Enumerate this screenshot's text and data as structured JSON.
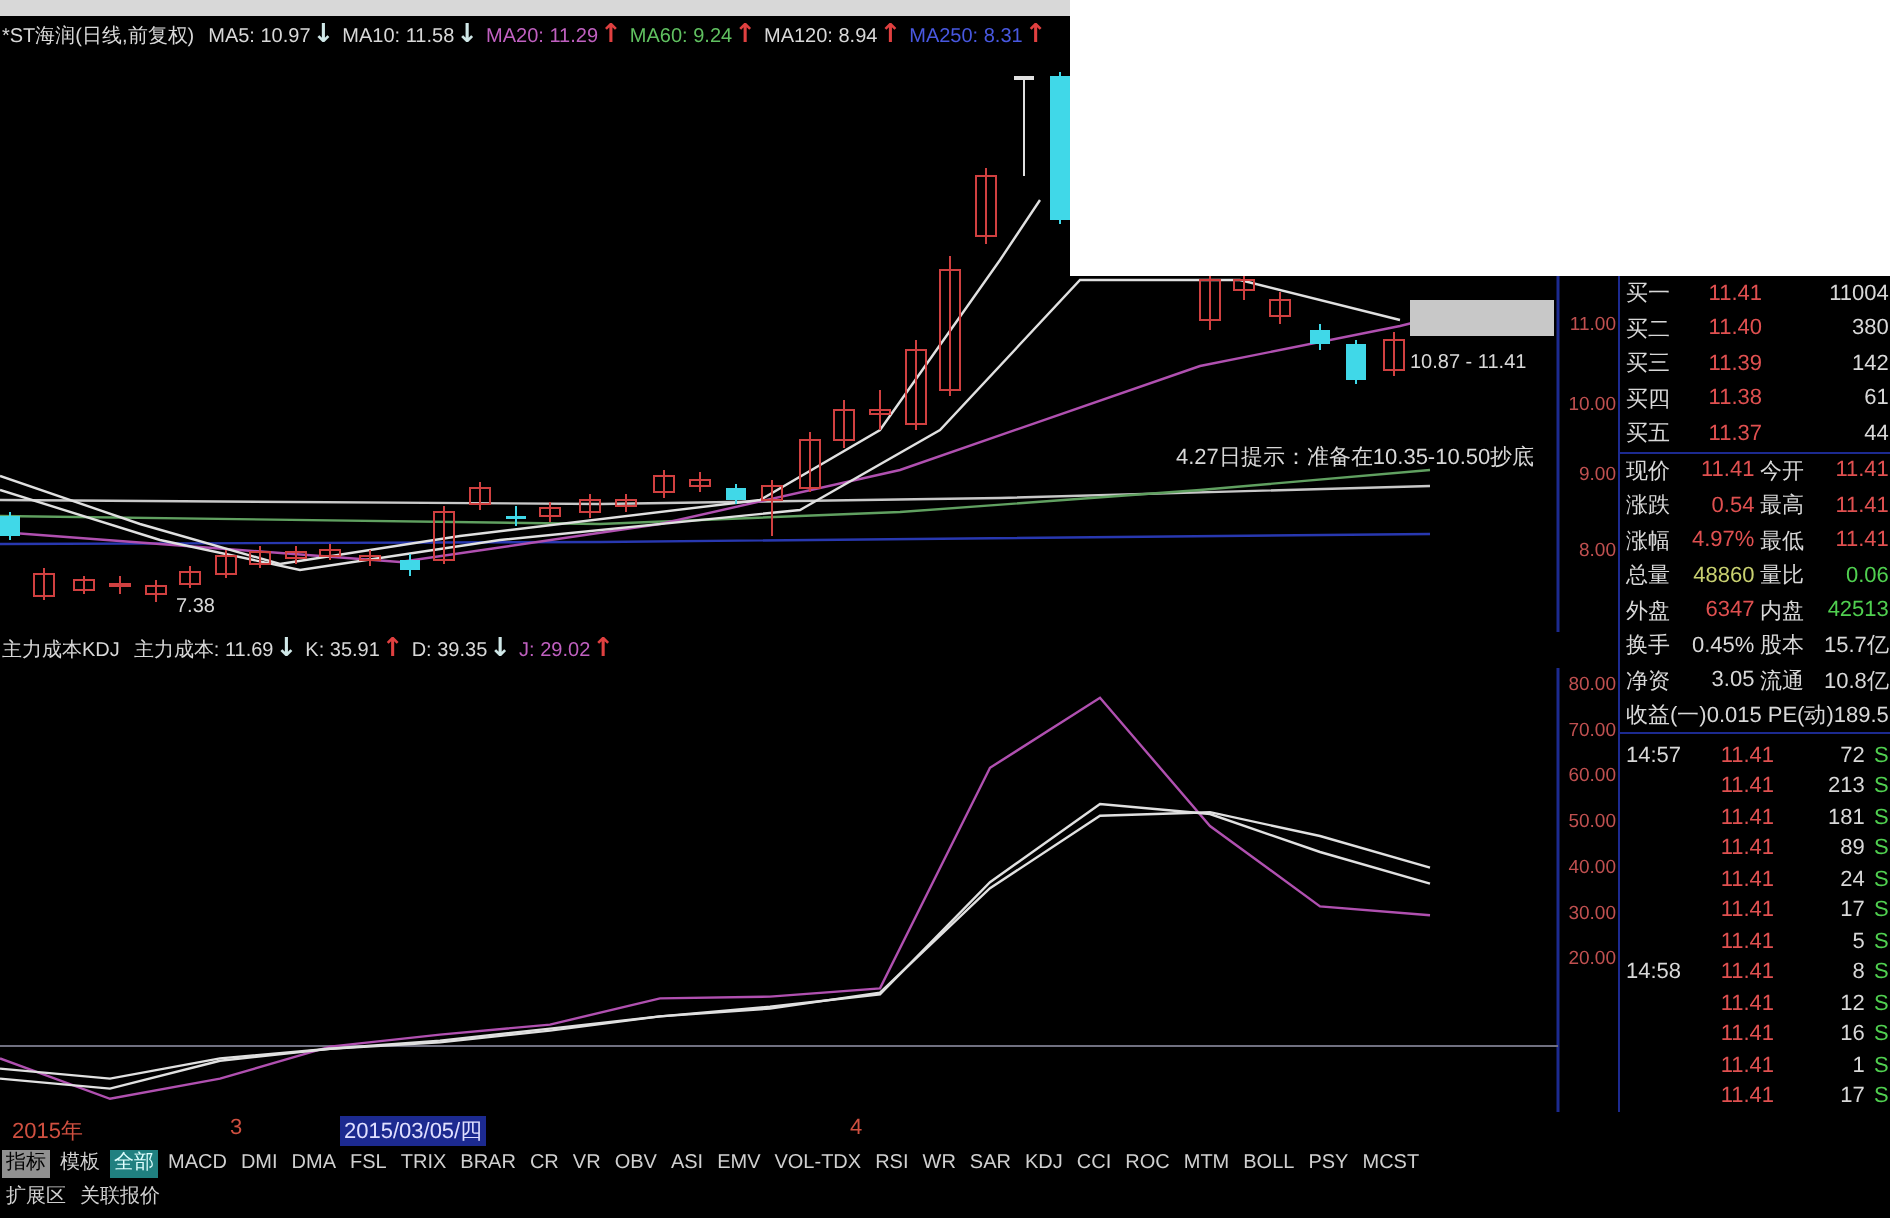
{
  "price_legend": {
    "title": "*ST海润(日线,前复权)",
    "indicators": [
      {
        "label": "MA5: 10.97",
        "color": "#d8d8d8",
        "arrow": {
          "symbol": "↓",
          "color": "#d0e8e8"
        }
      },
      {
        "label": "MA10: 11.58",
        "color": "#d8d8d8",
        "arrow": {
          "symbol": "↓",
          "color": "#d0e8e8"
        }
      },
      {
        "label": "MA20: 11.29",
        "color": "#c060c0",
        "arrow": {
          "symbol": "↑",
          "color": "#e04040"
        }
      },
      {
        "label": "MA60: 9.24",
        "color": "#60c060",
        "arrow": {
          "symbol": "↑",
          "color": "#e04040"
        }
      },
      {
        "label": "MA120: 8.94",
        "color": "#d8d8d8",
        "arrow": {
          "symbol": "↑",
          "color": "#e04040"
        }
      },
      {
        "label": "MA250: 8.31",
        "color": "#4858e0",
        "arrow": {
          "symbol": "↑",
          "color": "#e04040"
        }
      }
    ]
  },
  "price_chart": {
    "low_label": "7.38",
    "range_label": "10.87 - 11.41",
    "hint": "4.27日提示：准备在10.35-10.50抄底",
    "axis": [
      "11.00",
      "10.00",
      "9.00",
      "8.00"
    ]
  },
  "kdj_legend": {
    "title": "主力成本KDJ",
    "indicators": [
      {
        "label": "主力成本: 11.69",
        "color": "#d8d8d8",
        "arrow": {
          "symbol": "↓",
          "color": "#d0e8e8"
        }
      },
      {
        "label": "K: 35.91",
        "color": "#d8d8d8",
        "arrow": {
          "symbol": "↑",
          "color": "#e04040"
        }
      },
      {
        "label": "D: 39.35",
        "color": "#d8d8d8",
        "arrow": {
          "symbol": "↓",
          "color": "#d0e8e8"
        }
      },
      {
        "label": "J: 29.02",
        "color": "#c060c0",
        "arrow": {
          "symbol": "↑",
          "color": "#e04040"
        }
      }
    ]
  },
  "kdj_chart": {
    "chart_data": {
      "type": "line",
      "ylim": [
        -14,
        83
      ],
      "yticks": [
        {
          "value": 80,
          "label": "80.00"
        },
        {
          "value": 70,
          "label": "70.00"
        },
        {
          "value": 60,
          "label": "60.00"
        },
        {
          "value": 50,
          "label": "50.00"
        },
        {
          "value": 40,
          "label": "40.00"
        },
        {
          "value": 30,
          "label": "30.00"
        },
        {
          "value": 20,
          "label": "20.00"
        }
      ],
      "series": [
        {
          "color": "#b050b0",
          "values": [
            -2.3,
            -11.1,
            -6.7,
            0.3,
            2.9,
            5.1,
            10.8,
            11.2,
            13.0,
            61.2,
            76.5,
            48.5,
            30.9,
            29.0
          ]
        },
        {
          "color": "#e0e0e0",
          "values": [
            -6.7,
            -8.9,
            -2.8,
            -0.2,
            1.2,
            3.8,
            6.9,
            9.0,
            11.7,
            36.2,
            53.3,
            51.1,
            42.8,
            35.9
          ]
        },
        {
          "color": "#e0e0e0",
          "values": [
            -4.5,
            -6.7,
            -2.3,
            -0.2,
            1.6,
            4.2,
            6.9,
            8.6,
            12.1,
            34.9,
            50.7,
            51.5,
            46.3,
            39.4
          ]
        }
      ]
    }
  },
  "date_axis": [
    {
      "label": "2015年",
      "highlighted": false
    },
    {
      "label": "3",
      "highlighted": false
    },
    {
      "label": "2015/03/05/四",
      "highlighted": true
    },
    {
      "label": "4",
      "highlighted": false
    }
  ],
  "panel_tabs": [
    {
      "label": "指标",
      "selected": true
    },
    {
      "label": "模板",
      "selected": false
    }
  ],
  "indicator_tabs": [
    {
      "label": "全部",
      "selected": true
    },
    {
      "label": "MACD",
      "selected": false
    },
    {
      "label": "DMI",
      "selected": false
    },
    {
      "label": "DMA",
      "selected": false
    },
    {
      "label": "FSL",
      "selected": false
    },
    {
      "label": "TRIX",
      "selected": false
    },
    {
      "label": "BRAR",
      "selected": false
    },
    {
      "label": "CR",
      "selected": false
    },
    {
      "label": "VR",
      "selected": false
    },
    {
      "label": "OBV",
      "selected": false
    },
    {
      "label": "ASI",
      "selected": false
    },
    {
      "label": "EMV",
      "selected": false
    },
    {
      "label": "VOL-TDX",
      "selected": false
    },
    {
      "label": "RSI",
      "selected": false
    },
    {
      "label": "WR",
      "selected": false
    },
    {
      "label": "SAR",
      "selected": false
    },
    {
      "label": "KDJ",
      "selected": false
    },
    {
      "label": "CCI",
      "selected": false
    },
    {
      "label": "ROC",
      "selected": false
    },
    {
      "label": "MTM",
      "selected": false
    },
    {
      "label": "BOLL",
      "selected": false
    },
    {
      "label": "PSY",
      "selected": false
    },
    {
      "label": "MCST",
      "selected": false
    }
  ],
  "bottom_tabs": [
    "扩展区",
    "关联报价"
  ],
  "order_book": [
    {
      "label": "买一",
      "price": "11.41",
      "volume": "11004"
    },
    {
      "label": "买二",
      "price": "11.40",
      "volume": "380"
    },
    {
      "label": "买三",
      "price": "11.39",
      "volume": "142"
    },
    {
      "label": "买四",
      "price": "11.38",
      "volume": "61"
    },
    {
      "label": "买五",
      "price": "11.37",
      "volume": "44"
    }
  ],
  "quote": [
    {
      "label": "现价",
      "value": "11.41",
      "color": "#e05050"
    },
    {
      "label": "今开",
      "value": "11.41",
      "color": "#e05050"
    },
    {
      "label": "涨跌",
      "value": "0.54",
      "color": "#e05050"
    },
    {
      "label": "最高",
      "value": "11.41",
      "color": "#e05050"
    },
    {
      "label": "涨幅",
      "value": "4.97%",
      "color": "#e05050"
    },
    {
      "label": "最低",
      "value": "11.41",
      "color": "#e05050"
    },
    {
      "label": "总量",
      "value": "48860",
      "color": "#c8d070"
    },
    {
      "label": "量比",
      "value": "0.06",
      "color": "#50d050"
    },
    {
      "label": "外盘",
      "value": "6347",
      "color": "#e05050"
    },
    {
      "label": "内盘",
      "value": "42513",
      "color": "#50d050"
    },
    {
      "label": "换手",
      "value": "0.45%",
      "color": "#d8d8d8"
    },
    {
      "label": "股本",
      "value": "15.7亿",
      "color": "#d8d8d8"
    },
    {
      "label": "净资",
      "value": "3.05",
      "color": "#d8d8d8"
    },
    {
      "label": "流通",
      "value": "10.8亿",
      "color": "#d8d8d8"
    },
    {
      "label": "收益(一)",
      "value": "0.015",
      "color": "#d8d8d8"
    },
    {
      "label": "PE(动)",
      "value": "189.5",
      "color": "#d8d8d8"
    }
  ],
  "ticks": [
    {
      "time": "14:57",
      "price": "11.41",
      "volume": "72",
      "side": "S"
    },
    {
      "price": "11.41",
      "volume": "213",
      "side": "S"
    },
    {
      "price": "11.41",
      "volume": "181",
      "side": "S"
    },
    {
      "price": "11.41",
      "volume": "89",
      "side": "S"
    },
    {
      "price": "11.41",
      "volume": "24",
      "side": "S"
    },
    {
      "price": "11.41",
      "volume": "17",
      "side": "S"
    },
    {
      "price": "11.41",
      "volume": "5",
      "side": "S"
    },
    {
      "time": "14:58",
      "price": "11.41",
      "volume": "8",
      "side": "S"
    },
    {
      "price": "11.41",
      "volume": "12",
      "side": "S"
    },
    {
      "price": "11.41",
      "volume": "16",
      "side": "S"
    },
    {
      "price": "11.41",
      "volume": "1",
      "side": "S"
    },
    {
      "price": "11.41",
      "volume": "17",
      "side": "S"
    }
  ]
}
